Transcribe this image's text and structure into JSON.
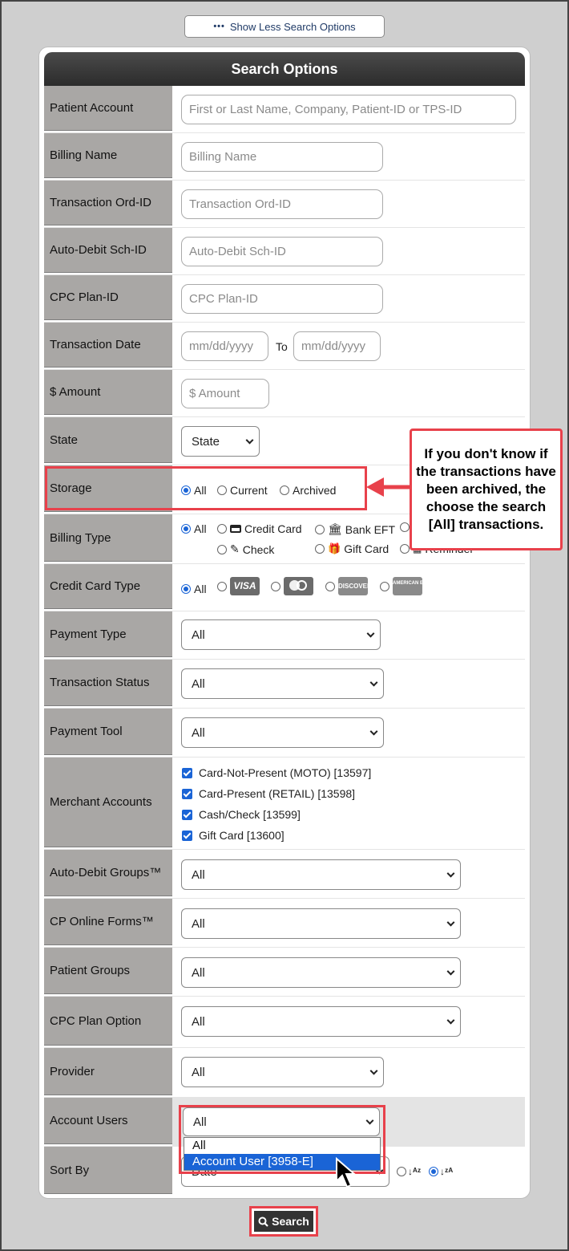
{
  "toggle_label": "Show Less Search Options",
  "panel_title": "Search Options",
  "fields": {
    "patient_account": {
      "label": "Patient Account",
      "placeholder": "First or Last Name, Company, Patient-ID or TPS-ID"
    },
    "billing_name": {
      "label": "Billing Name",
      "placeholder": "Billing Name"
    },
    "transaction_ord_id": {
      "label": "Transaction Ord-ID",
      "placeholder": "Transaction Ord-ID"
    },
    "auto_debit_sch_id": {
      "label": "Auto-Debit Sch-ID",
      "placeholder": "Auto-Debit Sch-ID"
    },
    "cpc_plan_id": {
      "label": "CPC Plan-ID",
      "placeholder": "CPC Plan-ID"
    },
    "transaction_date": {
      "label": "Transaction Date",
      "from_placeholder": "mm/dd/yyyy",
      "to_label": "To",
      "to_placeholder": "mm/dd/yyyy"
    },
    "amount": {
      "label": "$ Amount",
      "placeholder": "$ Amount"
    },
    "state": {
      "label": "State",
      "value": "State"
    },
    "storage": {
      "label": "Storage",
      "options": [
        "All",
        "Current",
        "Archived"
      ],
      "selected": "All"
    },
    "billing_type": {
      "label": "Billing Type",
      "options": [
        "All",
        "Credit Card",
        "Bank EFT",
        "Check",
        "Gift Card",
        "Reminder"
      ],
      "selected": "All"
    },
    "credit_card_type": {
      "label": "Credit Card Type",
      "all": "All",
      "cards": [
        "VISA",
        "mastercard",
        "DISCOVER",
        "AMERICAN EXPRESS"
      ]
    },
    "payment_type": {
      "label": "Payment Type",
      "value": "All"
    },
    "transaction_status": {
      "label": "Transaction Status",
      "value": "All"
    },
    "payment_tool": {
      "label": "Payment Tool",
      "value": "All"
    },
    "merchant_accounts": {
      "label": "Merchant Accounts",
      "items": [
        "Card-Not-Present (MOTO) [13597]",
        "Card-Present (RETAIL) [13598]",
        "Cash/Check [13599]",
        "Gift Card [13600]"
      ]
    },
    "auto_debit_groups": {
      "label": "Auto-Debit Groups™",
      "value": "All"
    },
    "cp_online_forms": {
      "label": "CP Online Forms™",
      "value": "All"
    },
    "patient_groups": {
      "label": "Patient Groups",
      "value": "All"
    },
    "cpc_plan_option": {
      "label": "CPC Plan Option",
      "value": "All"
    },
    "provider": {
      "label": "Provider",
      "value": "All"
    },
    "account_users": {
      "label": "Account Users",
      "value": "All",
      "options": [
        "All",
        "Account User [3958-E]"
      ],
      "highlighted": "Account User [3958-E]"
    },
    "sort_by": {
      "label": "Sort By",
      "value": "Date"
    }
  },
  "callout_text": "If you don't know if the transactions have been archived, the choose the search [All] transactions.",
  "search_label": "Search",
  "colors": {
    "accent": "#e8414b",
    "selection": "#1a64d6",
    "header": "#333333",
    "label_bg": "#a9a7a5"
  }
}
